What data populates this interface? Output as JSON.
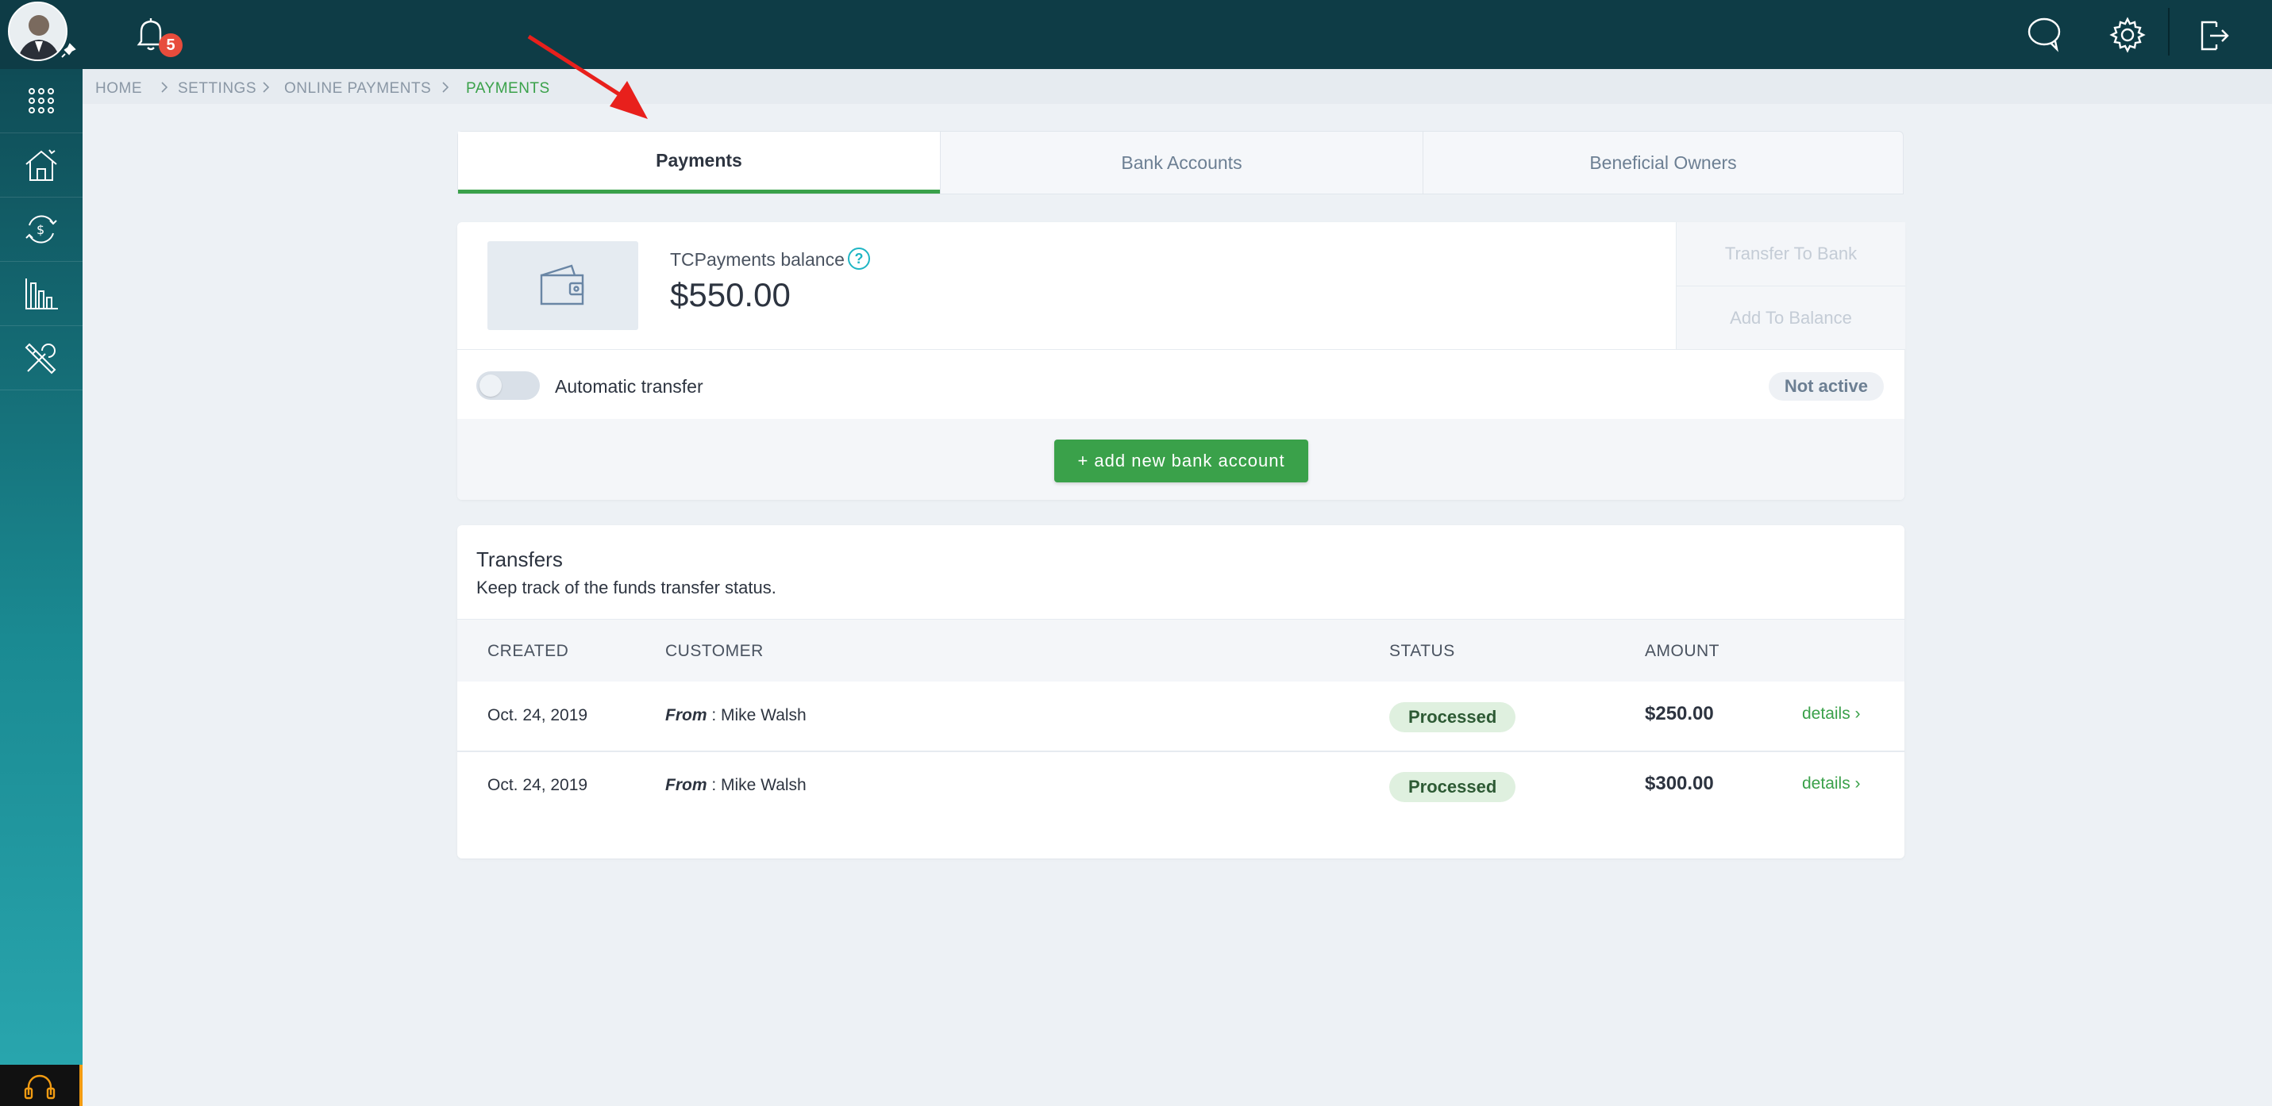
{
  "header": {
    "notification_count": "5",
    "icons": [
      "bell-icon",
      "chat-icon",
      "gear-icon",
      "logout-icon"
    ]
  },
  "sidebar": {
    "items": [
      {
        "icon": "apps-grid-icon"
      },
      {
        "icon": "home-icon"
      },
      {
        "icon": "money-cycle-icon"
      },
      {
        "icon": "bar-chart-icon"
      },
      {
        "icon": "tools-icon"
      }
    ],
    "support_icon": "headset-icon"
  },
  "breadcrumb": {
    "items": [
      "HOME",
      "SETTINGS",
      "ONLINE PAYMENTS",
      "PAYMENTS"
    ]
  },
  "tabs": {
    "items": [
      "Payments",
      "Bank Accounts",
      "Beneficial Owners"
    ],
    "active": "Payments"
  },
  "balance": {
    "label": "TCPayments balance",
    "help": "?",
    "amount": "$550.00",
    "transfer_to_bank": "Transfer To Bank",
    "add_to_balance": "Add To Balance",
    "auto_transfer_label": "Automatic transfer",
    "auto_transfer_status": "Not active",
    "add_bank_button": "+ add new bank account"
  },
  "transfers": {
    "title": "Transfers",
    "subtitle": "Keep track of the funds transfer status.",
    "columns": [
      "CREATED",
      "CUSTOMER",
      "STATUS",
      "AMOUNT"
    ],
    "rows": [
      {
        "created": "Oct. 24, 2019",
        "from_label": "From",
        "customer": " : Mike Walsh",
        "status": "Processed",
        "amount": "$250.00",
        "details": "details ›"
      },
      {
        "created": "Oct. 24, 2019",
        "from_label": "From",
        "customer": " : Mike Walsh",
        "status": "Processed",
        "amount": "$300.00",
        "details": "details ›"
      }
    ]
  },
  "colors": {
    "topbar": "#0e3c46",
    "accent_green": "#3aa14a",
    "help_teal": "#1fb5c4",
    "badge_red": "#e74c3c",
    "annotation_red": "#e8201c"
  }
}
